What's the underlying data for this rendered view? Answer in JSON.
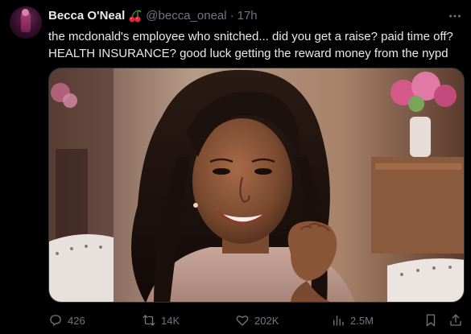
{
  "author": {
    "name": "Becca O'Neal",
    "handle": "@becca_oneal",
    "separator": "·",
    "time": "17h",
    "emoji_icon": "cherries-icon"
  },
  "tweet": {
    "text_line1": "the mcdonald's employee who snitched... did you get a raise? paid time off?",
    "text_line2": "HEALTH INSURANCE? good luck getting the reward money from the nypd"
  },
  "media": {
    "type": "photo",
    "subject": "smiling-woman-photo"
  },
  "actions": {
    "replies": "426",
    "retweets": "14K",
    "likes": "202K",
    "views": "2.5M"
  },
  "colors": {
    "background": "#000000",
    "text": "#e7e9ea",
    "muted": "#71767b",
    "border": "#2f3336"
  }
}
